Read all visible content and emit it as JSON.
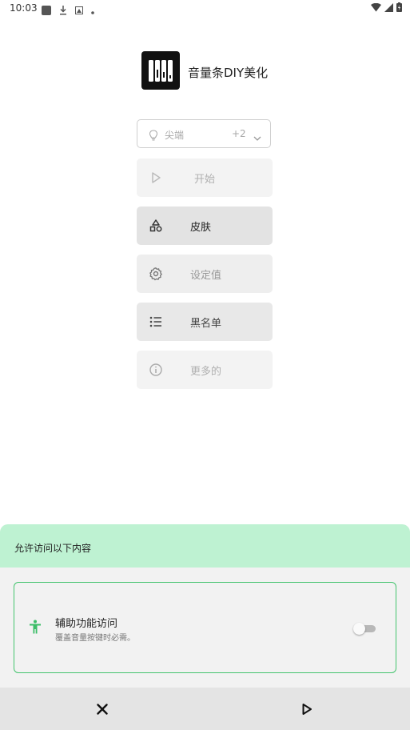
{
  "status_bar": {
    "time": "10:03"
  },
  "app": {
    "title": "音量条DIY美化"
  },
  "selector": {
    "label": "尖端",
    "count": "+2"
  },
  "menu": {
    "start": "开始",
    "skin": "皮肤",
    "settings": "设定值",
    "blacklist": "黑名单",
    "more": "更多的"
  },
  "permission_sheet": {
    "title": "允许访问以下内容",
    "item_title": "辅助功能访问",
    "item_subtitle": "覆盖音量按键时必需。",
    "toggle_on": false
  },
  "colors": {
    "accent": "#44c46e",
    "sheet_header": "#bef2d2"
  }
}
